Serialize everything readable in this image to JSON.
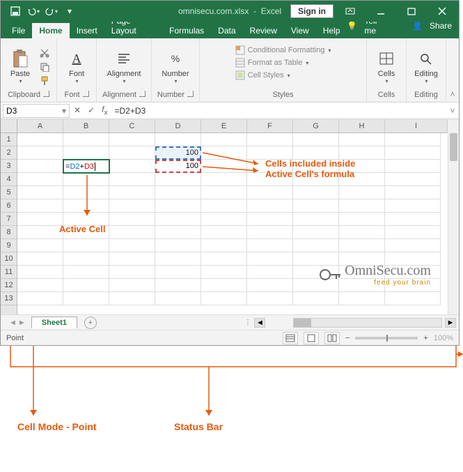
{
  "title": {
    "filename": "omnisecu.com.xlsx",
    "app": "Excel"
  },
  "signin": "Sign in",
  "tabs": {
    "file": "File",
    "home": "Home",
    "insert": "Insert",
    "pagelayout": "Page Layout",
    "formulas": "Formulas",
    "data": "Data",
    "review": "Review",
    "view": "View",
    "help": "Help",
    "tellme": "Tell me",
    "share": "Share"
  },
  "ribbon": {
    "clipboard": {
      "paste": "Paste",
      "label": "Clipboard"
    },
    "font": {
      "btn": "Font",
      "label": "Font"
    },
    "alignment": {
      "btn": "Alignment",
      "label": "Alignment"
    },
    "number": {
      "btn": "Number",
      "label": "Number"
    },
    "styles": {
      "cond": "Conditional Formatting",
      "table": "Format as Table",
      "cellstyles": "Cell Styles",
      "label": "Styles"
    },
    "cells": {
      "btn": "Cells",
      "label": "Cells"
    },
    "editing": {
      "btn": "Editing",
      "label": "Editing"
    }
  },
  "namebox": "D3",
  "formula": "=D2+D3",
  "columns": [
    "A",
    "B",
    "C",
    "D",
    "E",
    "F",
    "G",
    "H",
    "I"
  ],
  "rows": [
    "1",
    "2",
    "3",
    "4",
    "5",
    "6",
    "7",
    "8",
    "9",
    "10",
    "11",
    "12",
    "13"
  ],
  "cells": {
    "d2": "100",
    "d3": "100",
    "b3_text": "=",
    "b3_p1": "D2",
    "b3_plus": "+",
    "b3_p2": "D3"
  },
  "annotations": {
    "cells_included_1": "Cells included inside",
    "cells_included_2": "Active Cell's formula",
    "active_cell": "Active Cell",
    "cell_mode": "Cell Mode - Point",
    "status_bar": "Status Bar"
  },
  "sheet": {
    "name": "Sheet1"
  },
  "status": {
    "mode": "Point",
    "zoom": "100%"
  },
  "watermark": {
    "brand": "OmniSecu.com",
    "tagline": "feed your brain"
  }
}
